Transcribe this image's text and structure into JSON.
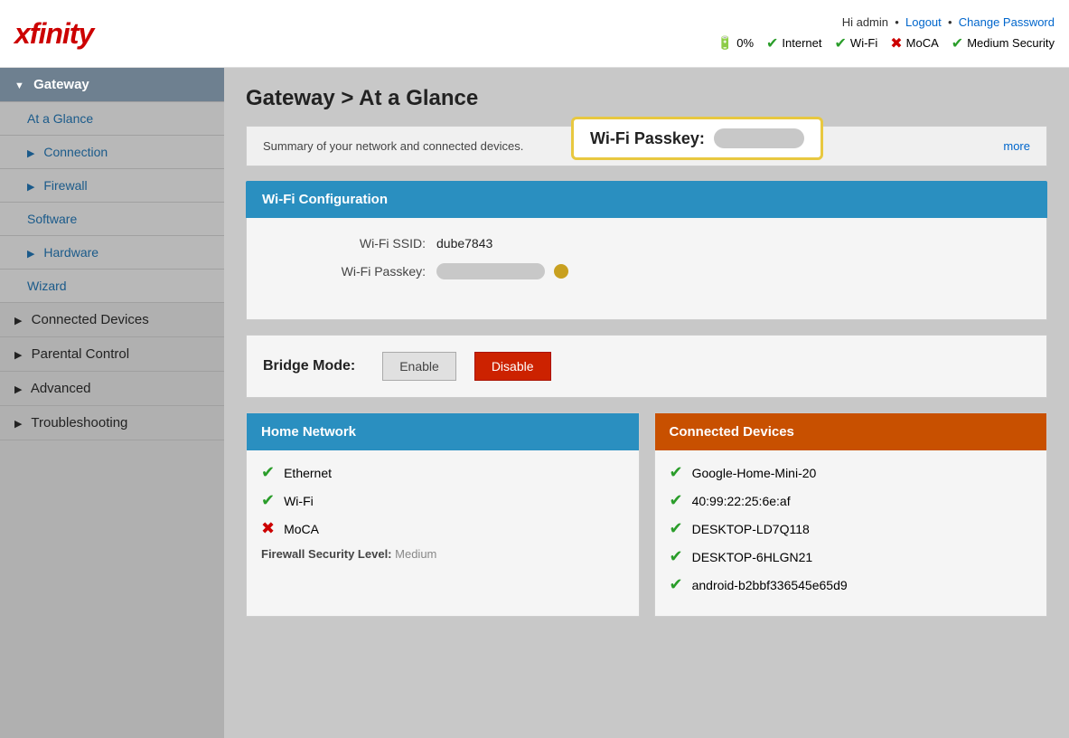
{
  "header": {
    "logo": "xfinity",
    "user": "Hi admin",
    "logout": "Logout",
    "change_password": "Change Password",
    "status": {
      "battery": "0%",
      "internet": "Internet",
      "wifi": "Wi-Fi",
      "moca": "MoCA",
      "security": "Medium Security"
    }
  },
  "sidebar": {
    "items": [
      {
        "id": "gateway",
        "label": "Gateway",
        "active": true,
        "hasArrow": true
      },
      {
        "id": "at-a-glance",
        "label": "At a Glance",
        "sub": true,
        "activeSub": true
      },
      {
        "id": "connection",
        "label": "Connection",
        "hasArrow": true
      },
      {
        "id": "firewall",
        "label": "Firewall",
        "hasArrow": true
      },
      {
        "id": "software",
        "label": "Software"
      },
      {
        "id": "hardware",
        "label": "Hardware",
        "hasArrow": true
      },
      {
        "id": "wizard",
        "label": "Wizard"
      },
      {
        "id": "connected-devices",
        "label": "Connected Devices",
        "hasArrow": true
      },
      {
        "id": "parental-control",
        "label": "Parental Control",
        "hasArrow": true
      },
      {
        "id": "advanced",
        "label": "Advanced",
        "hasArrow": true
      },
      {
        "id": "troubleshooting",
        "label": "Troubleshooting",
        "hasArrow": true
      }
    ]
  },
  "main": {
    "title": "Gateway > At a Glance",
    "summary_text": "Summary of your network and connected devices.",
    "more_link": "more",
    "wifi_config": {
      "header": "Wi-Fi Configuration",
      "ssid_label": "Wi-Fi SSID:",
      "ssid_value": "dube7843",
      "passkey_label": "Wi-Fi Passkey:"
    },
    "tooltip": {
      "label": "Wi-Fi Passkey:"
    },
    "bridge_mode": {
      "label": "Bridge Mode:",
      "enable": "Enable",
      "disable": "Disable"
    },
    "home_network": {
      "header": "Home Network",
      "items": [
        {
          "label": "Ethernet",
          "status": "ok"
        },
        {
          "label": "Wi-Fi",
          "status": "ok"
        },
        {
          "label": "MoCA",
          "status": "error"
        }
      ],
      "firewall_label": "Firewall Security Level:",
      "firewall_value": "Medium"
    },
    "connected_devices": {
      "header": "Connected Devices",
      "items": [
        {
          "label": "Google-Home-Mini-20",
          "status": "ok"
        },
        {
          "label": "40:99:22:25:6e:af",
          "status": "ok"
        },
        {
          "label": "DESKTOP-LD7Q118",
          "status": "ok"
        },
        {
          "label": "DESKTOP-6HLGN21",
          "status": "ok"
        },
        {
          "label": "android-b2bbf336545e65d9",
          "status": "ok"
        }
      ]
    }
  }
}
